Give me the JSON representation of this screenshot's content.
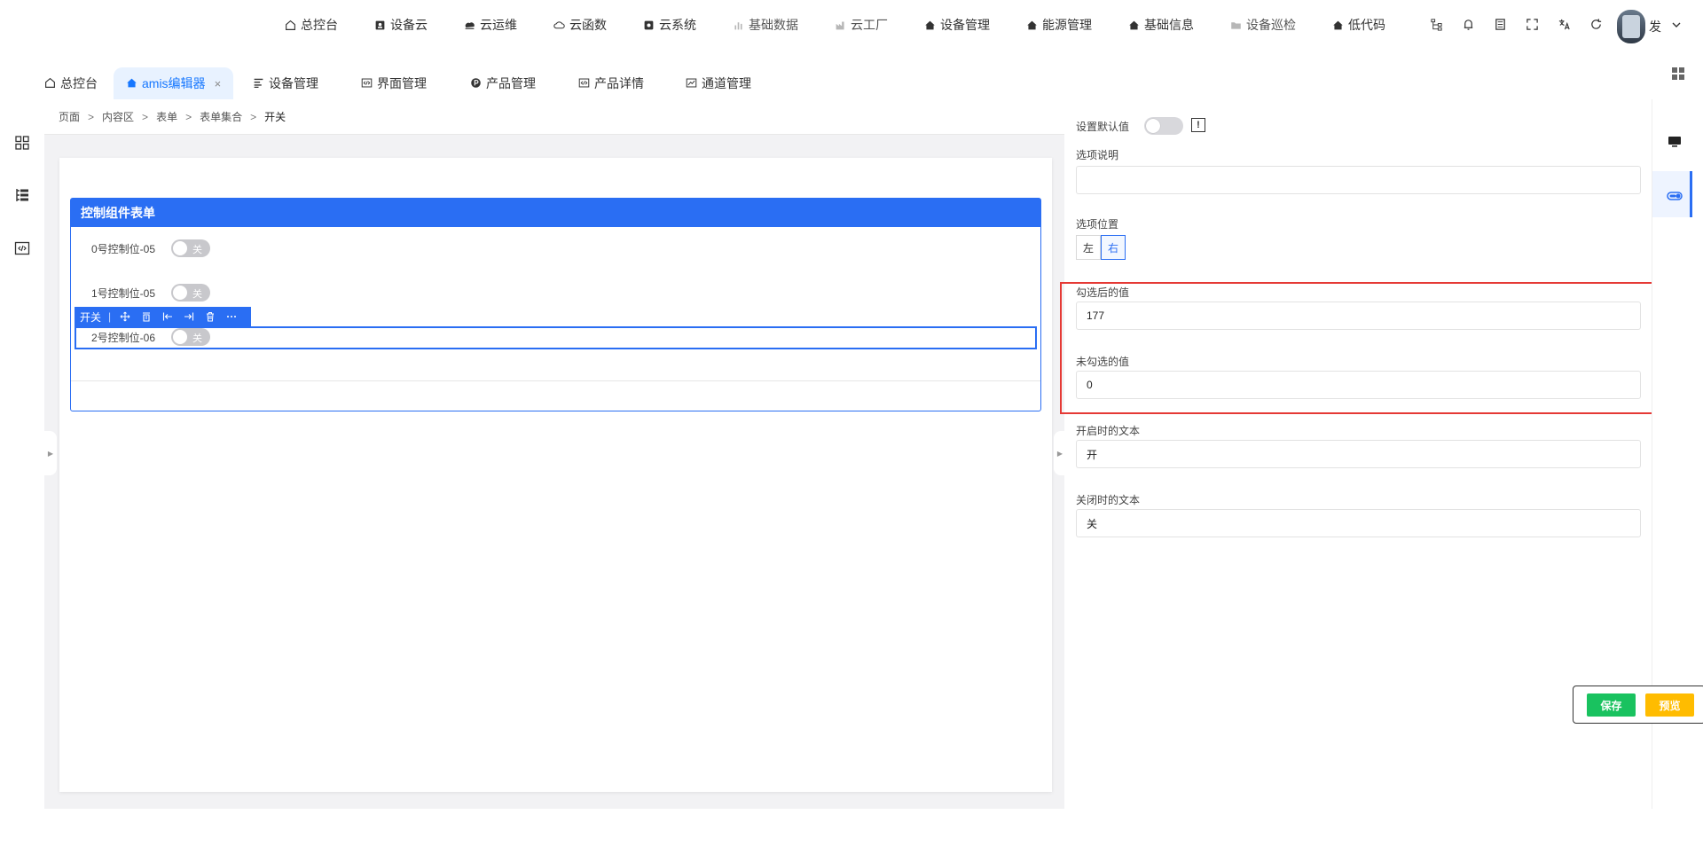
{
  "topnav": {
    "items": [
      {
        "label": "总控台",
        "icon": "home-icon"
      },
      {
        "label": "设备云",
        "icon": "device-cloud-icon"
      },
      {
        "label": "云运维",
        "icon": "cloud-ops-icon"
      },
      {
        "label": "云函数",
        "icon": "cloud-function-icon"
      },
      {
        "label": "云系统",
        "icon": "cloud-system-icon"
      },
      {
        "label": "基础数据",
        "icon": "bar-chart-icon"
      },
      {
        "label": "云工厂",
        "icon": "factory-icon"
      },
      {
        "label": "设备管理",
        "icon": "home-filled-icon"
      },
      {
        "label": "能源管理",
        "icon": "home-filled-icon"
      },
      {
        "label": "基础信息",
        "icon": "home-filled-icon"
      },
      {
        "label": "设备巡检",
        "icon": "folder-icon"
      },
      {
        "label": "低代码",
        "icon": "home-filled-icon"
      }
    ],
    "user_name": "发"
  },
  "tabs": [
    {
      "label": "总控台",
      "icon": "home-outline-icon"
    },
    {
      "label": "amis编辑器",
      "icon": "home-filled-icon",
      "close": "×"
    },
    {
      "label": "设备管理",
      "icon": "list-icon"
    },
    {
      "label": "界面管理",
      "icon": "code-icon"
    },
    {
      "label": "产品管理",
      "icon": "p-circle-icon"
    },
    {
      "label": "产品详情",
      "icon": "code-icon"
    },
    {
      "label": "通道管理",
      "icon": "chart-icon"
    }
  ],
  "breadcrumb": {
    "items": [
      "页面",
      "内容区",
      "表单",
      "表单集合",
      "开关"
    ],
    "sep": ">"
  },
  "form": {
    "title": "控制组件表单",
    "fields": [
      {
        "label": "0号控制位-05",
        "switch_text": "关",
        "on": false
      },
      {
        "label": "1号控制位-05",
        "switch_text": "关",
        "on": false
      },
      {
        "label": "2号控制位-06",
        "switch_text": "关",
        "on": false
      }
    ]
  },
  "selection_toolbar": {
    "label": "开关",
    "sep": "|",
    "tools": [
      "move-icon",
      "copy-icon",
      "insert-before-icon",
      "insert-after-icon",
      "delete-icon",
      "more-icon"
    ]
  },
  "panel": {
    "default_value_label": "设置默认值",
    "info_mark": "!",
    "option_desc_label": "选项说明",
    "option_desc_value": "",
    "option_pos_label": "选项位置",
    "pos_left": "左",
    "pos_right": "右",
    "checked_value_label": "勾选后的值",
    "checked_value": "177",
    "unchecked_value_label": "未勾选的值",
    "unchecked_value": "0",
    "on_text_label": "开启时的文本",
    "on_text": "开",
    "off_text_label": "关闭时的文本",
    "off_text": "关"
  },
  "actions": {
    "save": "保存",
    "preview": "预览"
  },
  "colors": {
    "primary": "#2a6ef3",
    "save": "#19c25f",
    "preview": "#ffbc00",
    "highlight": "#e53935"
  }
}
